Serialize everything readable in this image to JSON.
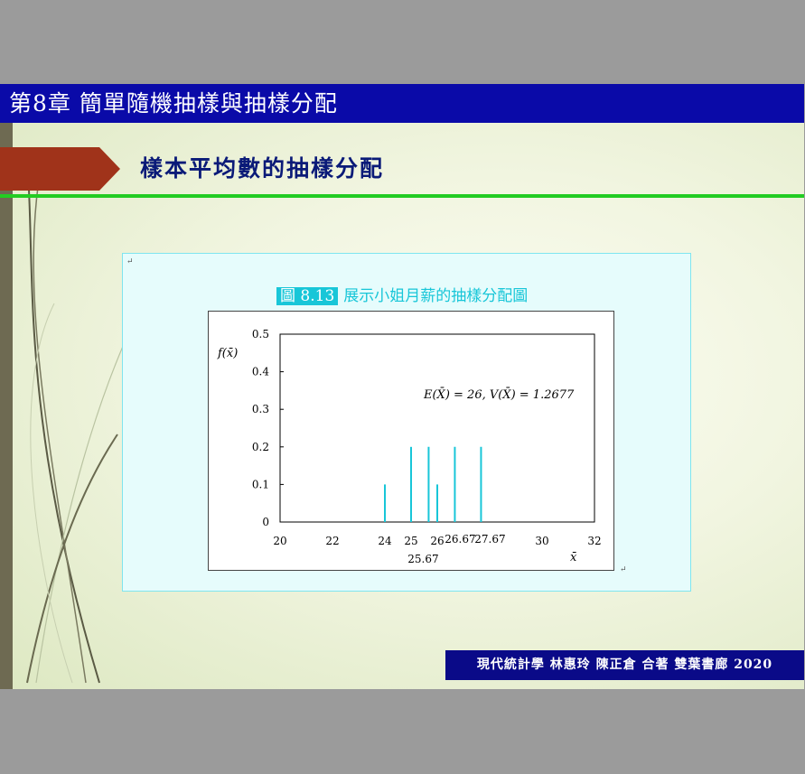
{
  "chapter": "第8章 簡單隨機抽樣與抽樣分配",
  "section_title": "樣本平均數的抽樣分配",
  "figure": {
    "badge": "圖 8.13",
    "caption": "展示小姐月薪的抽樣分配圖"
  },
  "footer": "現代統計學 林惠玲 陳正倉 合著 雙葉書廊 2020",
  "colors": {
    "chapter_bar": "#0a0aa8",
    "green_rule": "#22cc22",
    "arrow": "#a0331a",
    "bars": "#18c6d8",
    "footer": "#0a0a88"
  },
  "chart_data": {
    "type": "bar",
    "ylabel": "f(x̄)",
    "xlabel": "x̄",
    "annotation": "E(X̄) = 26,   V(X̄) = 1.2677",
    "xlim": [
      20,
      32
    ],
    "ylim": [
      0,
      0.5
    ],
    "x_ticks": [
      "20",
      "22",
      "24",
      "25",
      "26",
      "30",
      "32"
    ],
    "x_extra_labels": [
      "26.67",
      "27.67",
      "25.67"
    ],
    "y_ticks": [
      "0",
      "0.1",
      "0.2",
      "0.3",
      "0.4",
      "0.5"
    ],
    "series": [
      {
        "x": [
          24,
          25,
          25.67,
          26,
          26.67,
          27.67
        ],
        "values": [
          0.1,
          0.2,
          0.2,
          0.1,
          0.2,
          0.2
        ]
      }
    ],
    "grid": false
  }
}
